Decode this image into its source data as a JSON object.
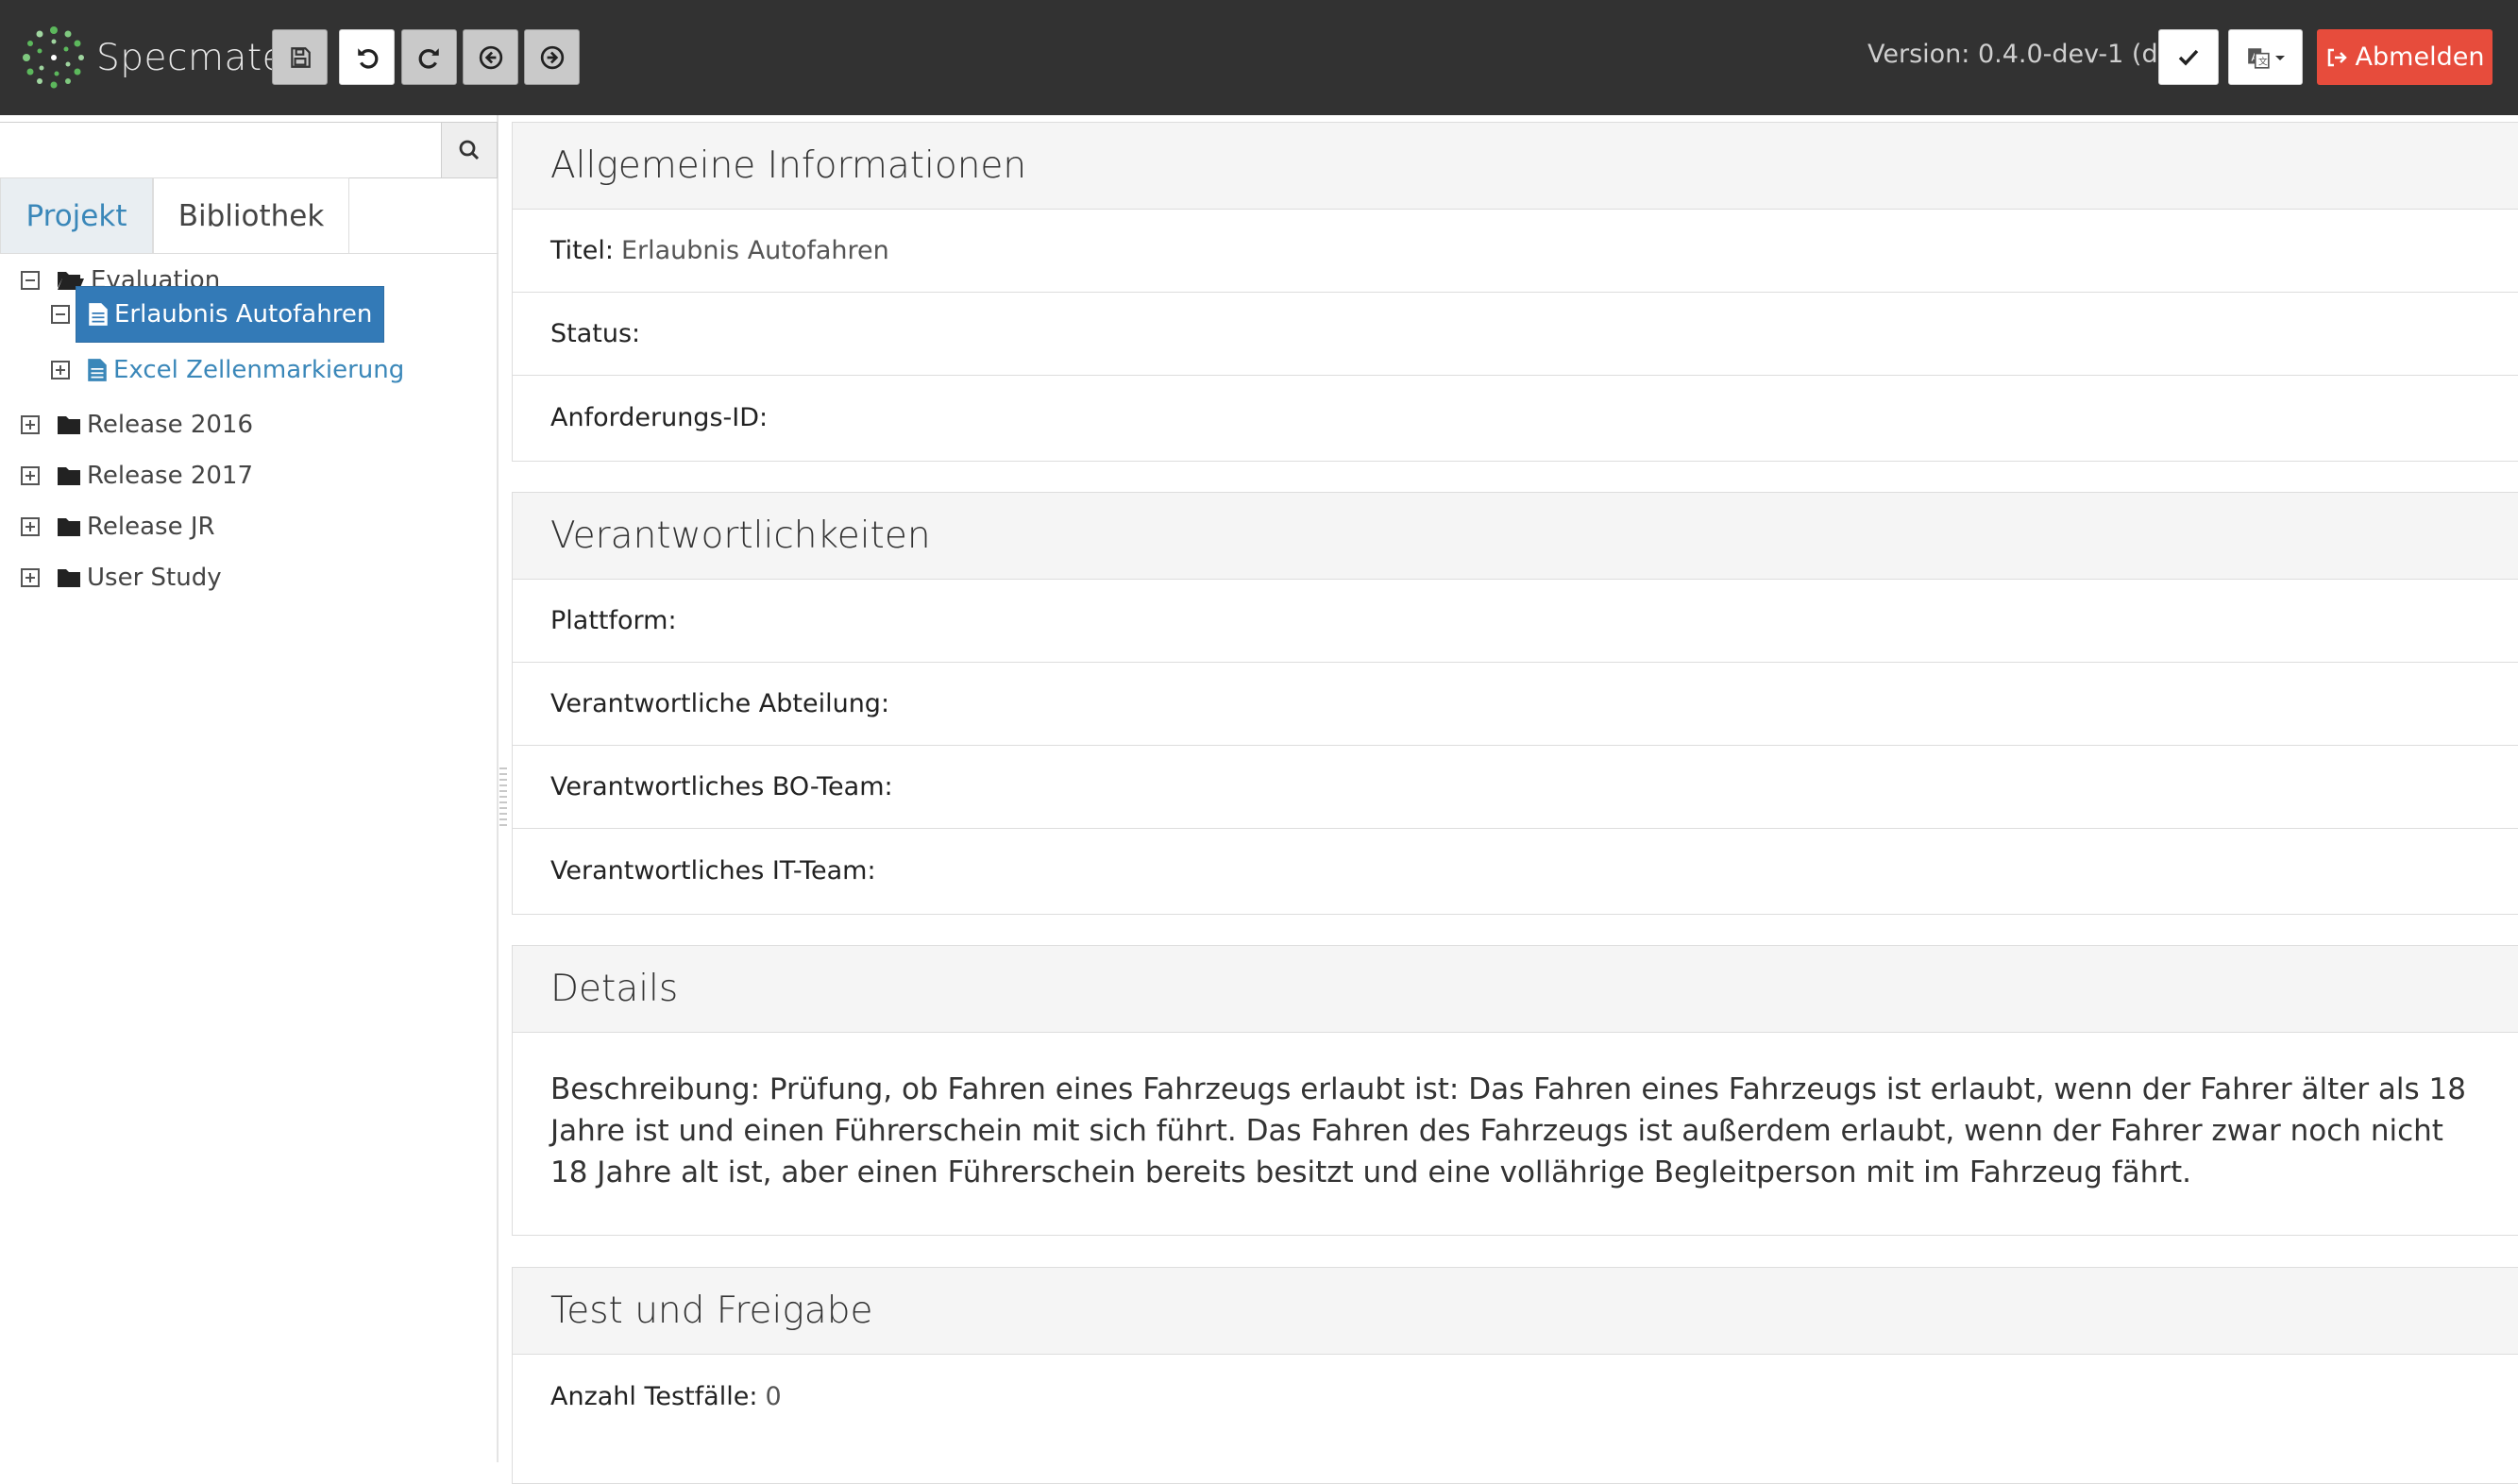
{
  "app": {
    "name": "Specmate",
    "version": "Version: 0.4.0-dev-1 (dev)",
    "logout_label": "Abmelden"
  },
  "toolbar": {
    "icons": [
      "save-icon",
      "undo-icon",
      "redo-icon",
      "back-icon",
      "forward-icon"
    ]
  },
  "sidebar": {
    "search_placeholder": "",
    "search_value": "",
    "tabs": [
      {
        "label": "Projekt",
        "active": true
      },
      {
        "label": "Bibliothek",
        "active": false
      }
    ],
    "tree": [
      {
        "label": "Evaluation",
        "type": "folder",
        "expanded": true,
        "level": 0
      },
      {
        "label": "Erlaubnis Autofahren",
        "type": "requirement",
        "expanded": true,
        "level": 1,
        "selected": true
      },
      {
        "label": "Excel Zellenmarkierung",
        "type": "requirement",
        "expanded": false,
        "level": 1,
        "selected": false
      },
      {
        "label": "Release 2016",
        "type": "folder",
        "expanded": false,
        "level": 0
      },
      {
        "label": "Release 2017",
        "type": "folder",
        "expanded": false,
        "level": 0
      },
      {
        "label": "Release JR",
        "type": "folder",
        "expanded": false,
        "level": 0
      },
      {
        "label": "User Study",
        "type": "folder",
        "expanded": false,
        "level": 0
      }
    ]
  },
  "main": {
    "general": {
      "title": "Allgemeine Informationen",
      "titel_label": "Titel:",
      "titel_value": "Erlaubnis Autofahren",
      "status_label": "Status:",
      "status_value": "",
      "req_id_label": "Anforderungs-ID:",
      "req_id_value": ""
    },
    "responsibilities": {
      "title": "Verantwortlichkeiten",
      "platform_label": "Plattform:",
      "department_label": "Verantwortliche Abteilung:",
      "bo_team_label": "Verantwortliches BO-Team:",
      "it_team_label": "Verantwortliches IT-Team:"
    },
    "details": {
      "title": "Details",
      "description": "Beschreibung: Prüfung, ob Fahren eines Fahrzeugs erlaubt ist: Das Fahren eines Fahrzeugs ist erlaubt, wenn der Fahrer älter als 18 Jahre ist und einen Führerschein mit sich führt. Das Fahren des Fahrzeugs ist außerdem erlaubt, wenn der Fahrer zwar noch nicht 18 Jahre alt ist, aber einen Führerschein bereits besitzt und eine vollährige Begleitperson mit im Fahrzeug fährt."
    },
    "test": {
      "title": "Test und Freigabe",
      "count_label": "Anzahl Testfälle:",
      "count_value": "0"
    }
  },
  "colors": {
    "navbar": "#323232",
    "accent": "#337ab7",
    "logout": "#e74c3c"
  }
}
